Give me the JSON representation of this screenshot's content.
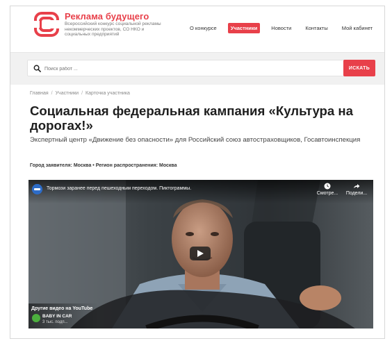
{
  "brand": {
    "title": "Реклама будущего",
    "subtitle": "Всероссийский конкурс социальной рекламы некоммерческих проектов, СО НКО и социальных предприятий",
    "accent": "#e8404a"
  },
  "nav": {
    "items": [
      {
        "label": "О конкурсе",
        "active": false
      },
      {
        "label": "Участники",
        "active": true
      },
      {
        "label": "Новости",
        "active": false
      },
      {
        "label": "Контакты",
        "active": false
      },
      {
        "label": "Мой кабинет",
        "active": false
      }
    ]
  },
  "search": {
    "placeholder": "Поиск работ ...",
    "button_label": "ИСКАТЬ",
    "icon": "search-icon"
  },
  "breadcrumb": [
    "Главная",
    "Участники",
    "Карточка участника"
  ],
  "page": {
    "title": "Социальная федеральная кампания «Культура на дорогах!»",
    "subtitle": "Экспертный центр «Движение без опасности» для Российский союз автостраховщиков, Госавтоинспекция",
    "meta": "Город заявителя: Москва • Регион распространения: Москва"
  },
  "video": {
    "title": "Тормози заранее перед пешеходным переходом. Пиктограммы.",
    "watch_later_label": "Смотре...",
    "share_label": "Подели...",
    "more_videos_label": "Другие видео на YouTube",
    "channel_name": "BABY IN CAR",
    "channel_subs": "3 тыс. подп..."
  }
}
